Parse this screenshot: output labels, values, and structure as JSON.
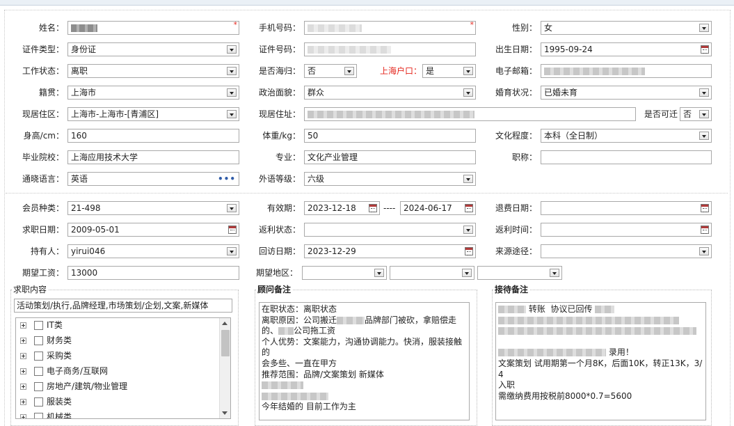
{
  "basic": {
    "name": {
      "label": "姓名：",
      "required_mark": "*"
    },
    "mobile": {
      "label": "手机号码：",
      "required_mark": "*"
    },
    "gender": {
      "label": "性别：",
      "value": "女"
    },
    "id_type": {
      "label": "证件类型：",
      "value": "身份证"
    },
    "id_number": {
      "label": "证件号码："
    },
    "birth_date": {
      "label": "出生日期：",
      "value": "1995-09-24"
    },
    "work_status": {
      "label": "工作状态：",
      "value": "离职"
    },
    "returnee": {
      "label": "是否海归：",
      "value": "否"
    },
    "shanghai_hukou": {
      "label": "上海户口：",
      "value": "是"
    },
    "email": {
      "label": "电子邮箱："
    },
    "native_place": {
      "label": "籍贯：",
      "value": "上海市"
    },
    "political": {
      "label": "政治面貌：",
      "value": "群众"
    },
    "marital": {
      "label": "婚育状况：",
      "value": "已婚未育"
    },
    "living_area": {
      "label": "现居住区：",
      "value": "上海市-上海市-[青浦区]"
    },
    "address": {
      "label": "现居住址："
    },
    "relocate": {
      "label": "是否可迁",
      "value": "否"
    },
    "height": {
      "label": "身高/cm：",
      "value": "160"
    },
    "weight": {
      "label": "体重/kg：",
      "value": "50"
    },
    "education": {
      "label": "文化程度：",
      "value": "本科（全日制）"
    },
    "school": {
      "label": "毕业院校：",
      "value": "上海应用技术大学"
    },
    "major": {
      "label": "专业：",
      "value": "文化产业管理"
    },
    "title": {
      "label": "职称：",
      "value": ""
    },
    "language": {
      "label": "通晓语言：",
      "value": "英语",
      "more": "•••"
    },
    "foreign_level": {
      "label": "外语等级：",
      "value": "六级"
    }
  },
  "membership": {
    "member_type": {
      "label": "会员种类：",
      "value": "21-498"
    },
    "validity": {
      "label": "有效期：",
      "start": "2023-12-18",
      "separator": "----",
      "end": "2024-06-17"
    },
    "refund_date": {
      "label": "退费日期：",
      "value": ""
    },
    "apply_date": {
      "label": "求职日期：",
      "value": "2009-05-01"
    },
    "rebate_status": {
      "label": "返利状态：",
      "value": ""
    },
    "rebate_time": {
      "label": "返利时间：",
      "value": ""
    },
    "holder": {
      "label": "持有人：",
      "value": "yirui046"
    },
    "visit_date": {
      "label": "回访日期：",
      "value": "2023-12-29"
    },
    "source": {
      "label": "来源途径：",
      "value": ""
    },
    "expected_salary": {
      "label": "期望工资：",
      "value": "13000"
    },
    "expected_region": {
      "label": "期望地区："
    }
  },
  "job_content": {
    "title": "求职内容",
    "selected": "活动策划/执行,品牌经理,市场策划/企划,文案,新媒体",
    "categories": [
      "IT类",
      "财务类",
      "采购类",
      "电子商务/互联网",
      "房地产/建筑/物业管理",
      "服装类",
      "机械类"
    ]
  },
  "advisor_notes": {
    "title": "顾问备注",
    "l1": "在职状态：离职状态",
    "l2a": "离职原因：公司搬迁",
    "l2b": "品牌部门被砍，拿赔偿走",
    "l3a": "的、",
    "l3b": "公司拖工资",
    "l4": "个人优势：文案能力，沟通协调能力。快消，服装接触的",
    "l5": "会多些、一直在甲方",
    "l6": "推荐范围：品牌/文案策划 新媒体",
    "l9": "今年结婚的 目前工作为主"
  },
  "reception_notes": {
    "title": "接待备注",
    "l1a": "转账",
    "l1b": "协议已回传",
    "l5": "录用！",
    "l6": "文案策划 试用期第一个月8K，后面10K，转正13K，3/4",
    "l7": "入职",
    "l8": "需缴纳费用按税前8000*0.7=5600"
  }
}
